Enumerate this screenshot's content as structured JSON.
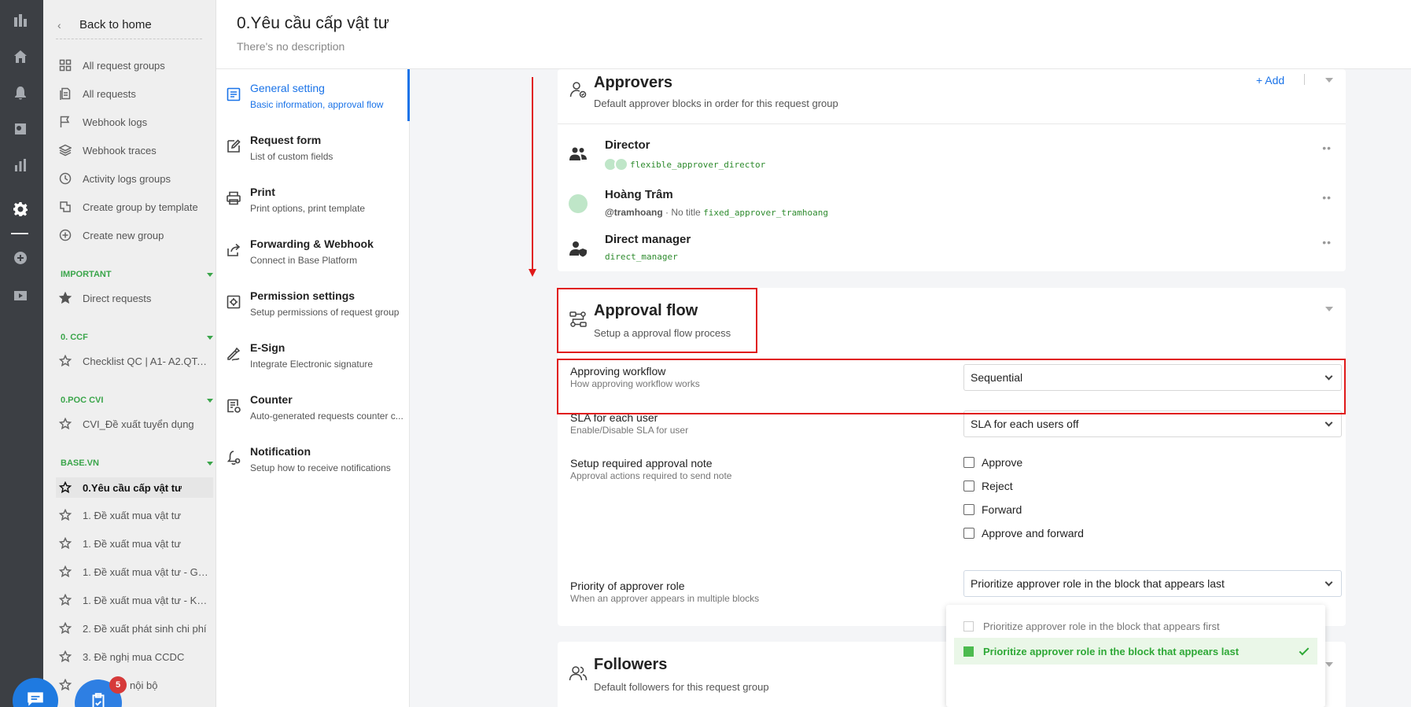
{
  "nav": {
    "back_label": "Back to home",
    "items": [
      {
        "label": "All request groups",
        "icon": "grid-icon"
      },
      {
        "label": "All requests",
        "icon": "documents-icon"
      },
      {
        "label": "Webhook logs",
        "icon": "flag-icon"
      },
      {
        "label": "Webhook traces",
        "icon": "layers-icon"
      },
      {
        "label": "Activity logs groups",
        "icon": "clock-icon"
      },
      {
        "label": "Create group by template",
        "icon": "template-icon"
      },
      {
        "label": "Create new group",
        "icon": "plus-circle-icon"
      }
    ],
    "sections": [
      {
        "title": "IMPORTANT",
        "items": [
          "Direct requests"
        ]
      },
      {
        "title": "0. CCF",
        "items": [
          "Checklist QC | A1- A2.QT.1..."
        ]
      },
      {
        "title": "0.POC CVI",
        "items": [
          "CVI_Đề xuất tuyển dụng"
        ]
      },
      {
        "title": "BASE.VN",
        "items": [
          "0.Yêu cầu cấp vật tư",
          "1. Đề xuất mua vật tư",
          "1. Đề xuất mua vật tư",
          "1. Đề xuất mua vật tư - Giá...",
          "1. Đề xuất mua vật tư - Kế ...",
          "2. Đề xuất phát sinh chi phí",
          "3. Đề nghị mua CCDC",
          "nội bộ"
        ]
      }
    ],
    "badge_count": "5"
  },
  "header": {
    "title": "0.Yêu cầu cấp vật tư",
    "description": "There's no description"
  },
  "menu": [
    {
      "title": "General setting",
      "subtitle": "Basic information, approval flow",
      "icon": "document-icon",
      "active": true
    },
    {
      "title": "Request form",
      "subtitle": "List of custom fields",
      "icon": "edit-icon"
    },
    {
      "title": "Print",
      "subtitle": "Print options, print template",
      "icon": "printer-icon"
    },
    {
      "title": "Forwarding & Webhook",
      "subtitle": "Connect in Base Platform",
      "icon": "share-icon"
    },
    {
      "title": "Permission settings",
      "subtitle": "Setup permissions of request group",
      "icon": "shield-gear-icon"
    },
    {
      "title": "E-Sign",
      "subtitle": "Integrate Electronic signature",
      "icon": "signature-icon"
    },
    {
      "title": "Counter",
      "subtitle": "Auto-generated requests counter c...",
      "icon": "counter-icon"
    },
    {
      "title": "Notification",
      "subtitle": "Setup how to receive notifications",
      "icon": "bell-gear-icon"
    }
  ],
  "approvers": {
    "title": "Approvers",
    "subtitle": "Default approver blocks in order for this request group",
    "add_label": "+ Add",
    "rows": [
      {
        "name": "Director",
        "code": "flexible_approver_director",
        "icon": "users-icon"
      },
      {
        "name": "Hoàng Trâm",
        "handle": "@tramhoang",
        "sep": " · No title ",
        "code": "fixed_approver_tramhoang",
        "icon": "avatar"
      },
      {
        "name": "Direct manager",
        "code": "direct_manager",
        "icon": "user-shield-icon"
      }
    ]
  },
  "approval_flow": {
    "title": "Approval flow",
    "subtitle": "Setup a approval flow process",
    "workflow": {
      "label": "Approving workflow",
      "sub": "How approving workflow works",
      "value": "Sequential"
    },
    "sla": {
      "label": "SLA for each user",
      "sub": "Enable/Disable SLA for user",
      "value": "SLA for each users off"
    },
    "note": {
      "label": "Setup required approval note",
      "sub": "Approval actions required to send note",
      "options": [
        "Approve",
        "Reject",
        "Forward",
        "Approve and forward"
      ]
    },
    "priority": {
      "label": "Priority of approver role",
      "sub": "When an approver appears in multiple blocks",
      "value": "Prioritize approver role in the block that appears last",
      "options": [
        "Prioritize approver role in the block that appears first",
        "Prioritize approver role in the block that appears last"
      ]
    }
  },
  "followers": {
    "title": "Followers",
    "subtitle": "Default followers for this request group"
  },
  "colors": {
    "accent": "#1a73e8",
    "green": "#3aa54a",
    "annotation_red": "#e01a1a",
    "rail": "#3c3f44"
  }
}
